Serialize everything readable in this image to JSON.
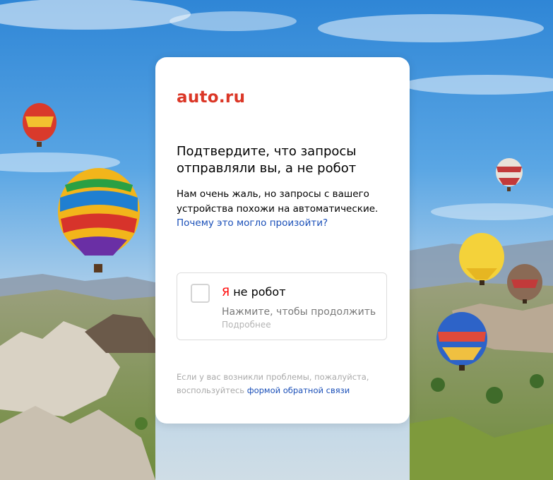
{
  "brand": {
    "logo_text": "auto.ru",
    "accent_color": "#db3727"
  },
  "captcha_page": {
    "title": "Подтвердите, что запросы отправляли вы, а не робот",
    "description": "Нам очень жаль, но запросы с вашего устройства похожи на автоматические.",
    "why_link": "Почему это могло произойти?",
    "captcha": {
      "ya_letter": "Я",
      "label_rest": " не робот",
      "hint": "Нажмите, чтобы продолжить",
      "more_link": "Подробнее",
      "checked": false
    },
    "footer_text": "Если у вас возникли проблемы, пожалуйста, воспользуйтесь",
    "feedback_link": "формой обратной связи"
  },
  "background": {
    "description_icon": "hot-air-balloons-landscape",
    "sky_color": "#4f9ee0",
    "land_color": "#8fa35a"
  }
}
